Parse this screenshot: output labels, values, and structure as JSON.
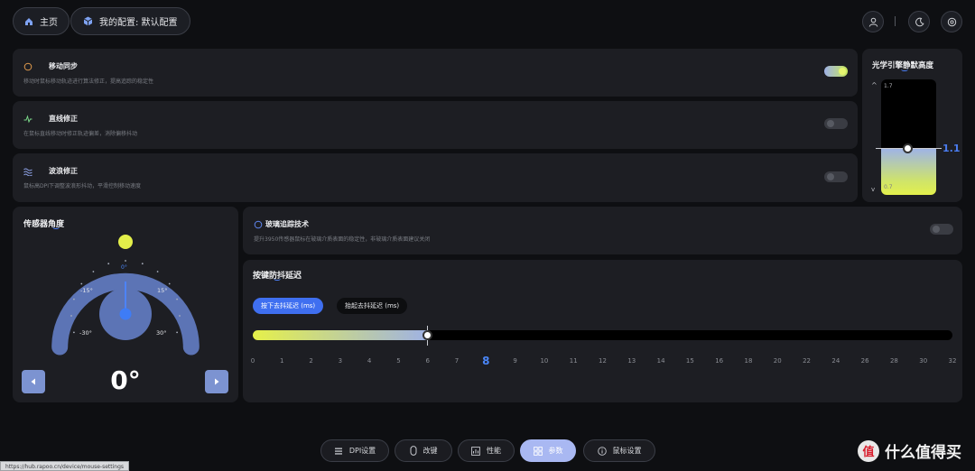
{
  "header": {
    "home_label": "主页",
    "profile_label": "我的配置: 默认配置",
    "icons": [
      "home-icon",
      "cube-icon",
      "user-icon",
      "moon-icon",
      "settings-icon"
    ]
  },
  "features": [
    {
      "title": "移动同步",
      "desc": "移动时鼠标移动轨迹进行算法修正，提高追踪的稳定性",
      "enabled": true
    },
    {
      "title": "直线修正",
      "desc": "在鼠标直线移动时修正轨迹偏差，消除偏移抖动",
      "enabled": false
    },
    {
      "title": "波浪修正",
      "desc": "鼠标高DPI下调整波浪形抖动，平滑控制移动速度",
      "enabled": false
    }
  ],
  "lod": {
    "title": "光学引擎静默高度",
    "max_label": "1.7",
    "min_label": "0.7",
    "current": "1.1",
    "up_arrow": "^",
    "down_arrow": "v",
    "fraction": 0.4
  },
  "sensor": {
    "title": "传感器角度",
    "labels": {
      "top": "0°",
      "left1": "-15°",
      "right1": "15°",
      "left2": "-30°",
      "right2": "30°"
    },
    "value": "0°"
  },
  "glass": {
    "title": "玻璃追踪技术",
    "desc": "提升3950传感器鼠标在玻璃介质表面的稳定性，非玻璃介质表面建议关闭",
    "enabled": false
  },
  "debounce": {
    "title": "按键防抖延迟",
    "tab_press": "按下去抖延迟 (ms)",
    "tab_release": "抬起去抖延迟 (ms)",
    "ticks": [
      "0",
      "1",
      "2",
      "3",
      "4",
      "5",
      "6",
      "7",
      "8",
      "9",
      "10",
      "11",
      "12",
      "13",
      "14",
      "15",
      "16",
      "18",
      "20",
      "22",
      "24",
      "26",
      "28",
      "30",
      "32"
    ],
    "selected": "8",
    "fraction": 0.25
  },
  "nav": {
    "items": [
      {
        "label": "DPI设置",
        "icon": "dpi-icon"
      },
      {
        "label": "改键",
        "icon": "mouse-icon"
      },
      {
        "label": "性能",
        "icon": "chart-icon"
      },
      {
        "label": "参数",
        "icon": "grid-icon"
      },
      {
        "label": "鼠标设置",
        "icon": "info-icon"
      }
    ],
    "active_index": 3
  },
  "status_url": "https://hub.rapoo.cn/device/mouse-settings",
  "watermark": "什么值得买",
  "colors": {
    "accent": "#4a7cf0",
    "toggle_on": "#c8e85a",
    "dial": "#6378b8",
    "card": "#1d1e23"
  }
}
